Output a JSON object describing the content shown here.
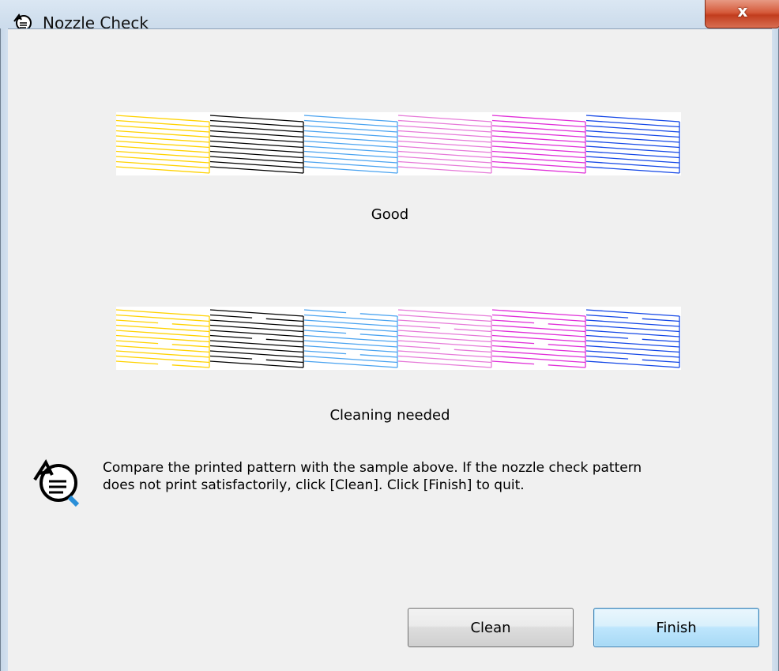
{
  "window": {
    "title": "Nozzle Check",
    "close_label": "x"
  },
  "patterns": [
    {
      "id": "good",
      "label": "Good",
      "state": "good"
    },
    {
      "id": "cleaning",
      "label": "Cleaning needed",
      "state": "gaps"
    }
  ],
  "ink_colors": [
    "#ffd200",
    "#000000",
    "#4aa3f0",
    "#e67ad8",
    "#e02fd8",
    "#1447e6"
  ],
  "message": {
    "line1": "Compare the printed pattern with the sample above. If the nozzle check pattern",
    "line2": "does not print satisfactorily, click [Clean]. Click [Finish] to quit."
  },
  "buttons": {
    "clean_label": "Clean",
    "finish_label": "Finish"
  },
  "icons": {
    "title": "nozzle-check-icon",
    "info": "nozzle-check-icon",
    "close": "close-icon"
  }
}
